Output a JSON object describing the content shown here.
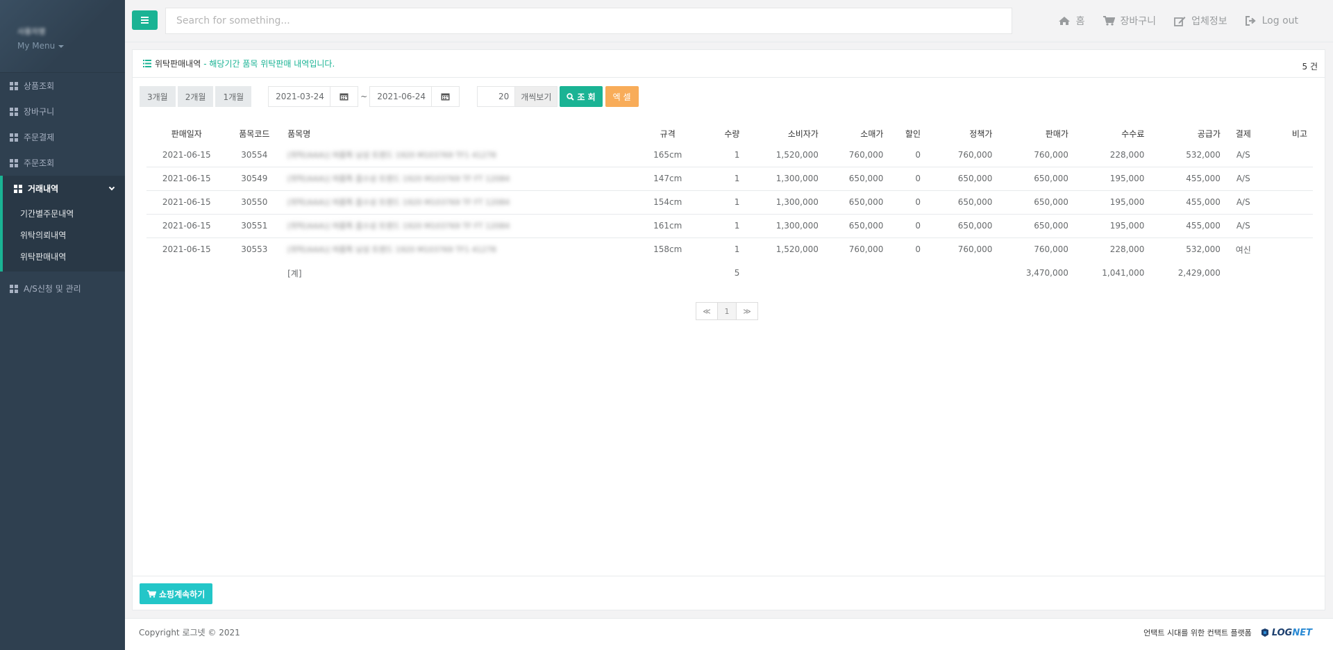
{
  "sidebar": {
    "profile_name": "사용자명",
    "my_menu": "My Menu",
    "items": [
      {
        "label": "상품조회"
      },
      {
        "label": "장바구니"
      },
      {
        "label": "주문결제"
      },
      {
        "label": "주문조회"
      },
      {
        "label": "거래내역"
      },
      {
        "label": "A/S신청 및 관리"
      }
    ],
    "subitems": [
      {
        "label": "기간별주문내역"
      },
      {
        "label": "위탁의뢰내역"
      },
      {
        "label": "위탁판매내역"
      }
    ]
  },
  "topbar": {
    "search_placeholder": "Search for something...",
    "home": "홈",
    "cart": "장바구니",
    "company": "업체정보",
    "logout": "Log out"
  },
  "panel": {
    "title": "위탁판매내역",
    "subtitle": "- 해당기간 품목 위탁판매 내역입니다.",
    "count": "5 건"
  },
  "filters": {
    "btn_3m": "3개월",
    "btn_2m": "2개월",
    "btn_1m": "1개월",
    "date_from": "2021-03-24",
    "date_to": "2021-06-24",
    "tilde": "~",
    "per_page": "20",
    "per_page_addon": "개씩보기",
    "search": "조 회",
    "excel": "엑 셀"
  },
  "table": {
    "headers": [
      "판매일자",
      "품목코드",
      "품목명",
      "규격",
      "수량",
      "소비자가",
      "소매가",
      "할인",
      "정책가",
      "판매가",
      "수수료",
      "공급가",
      "결제",
      "비고"
    ],
    "rows": [
      [
        "2021-06-15",
        "30554",
        "[위탁(AAA)] 여름특 남성 트렌드 1920 M103769 TF1 41278",
        "165cm",
        "1",
        "1,520,000",
        "760,000",
        "0",
        "760,000",
        "760,000",
        "228,000",
        "532,000",
        "A/S",
        ""
      ],
      [
        "2021-06-15",
        "30549",
        "[위탁(AAA)] 여름특 흡수성 트렌드 1920 M103769 TF FT 12084",
        "147cm",
        "1",
        "1,300,000",
        "650,000",
        "0",
        "650,000",
        "650,000",
        "195,000",
        "455,000",
        "A/S",
        ""
      ],
      [
        "2021-06-15",
        "30550",
        "[위탁(AAA)] 여름특 흡수성 트렌드 1920 M103769 TF FT 12084",
        "154cm",
        "1",
        "1,300,000",
        "650,000",
        "0",
        "650,000",
        "650,000",
        "195,000",
        "455,000",
        "A/S",
        ""
      ],
      [
        "2021-06-15",
        "30551",
        "[위탁(AAA)] 여름특 흡수성 트렌드 1920 M103769 TF FT 12084",
        "161cm",
        "1",
        "1,300,000",
        "650,000",
        "0",
        "650,000",
        "650,000",
        "195,000",
        "455,000",
        "A/S",
        ""
      ],
      [
        "2021-06-15",
        "30553",
        "[위탁(AAA)] 여름특 남성 트렌드 1920 M103769 TF1 41278",
        "158cm",
        "1",
        "1,520,000",
        "760,000",
        "0",
        "760,000",
        "760,000",
        "228,000",
        "532,000",
        "여신",
        ""
      ]
    ],
    "total": {
      "label": "[계]",
      "qty": "5",
      "sale": "3,470,000",
      "fee": "1,041,000",
      "supply": "2,429,000"
    }
  },
  "pager": {
    "prev": "≪",
    "current": "1",
    "next": "≫"
  },
  "footer": {
    "continue_shopping": "쇼핑계속하기",
    "copyright": "Copyright 로그넷 © 2021",
    "slogan": "언택트 시대를 위한 컨택트 플랫폼",
    "logo_a": "LOG",
    "logo_b": "NET"
  },
  "colors": {
    "accent": "#1ab394",
    "sidebar": "#2f4050",
    "orange": "#f8ac59",
    "cyan": "#23c6c8"
  }
}
